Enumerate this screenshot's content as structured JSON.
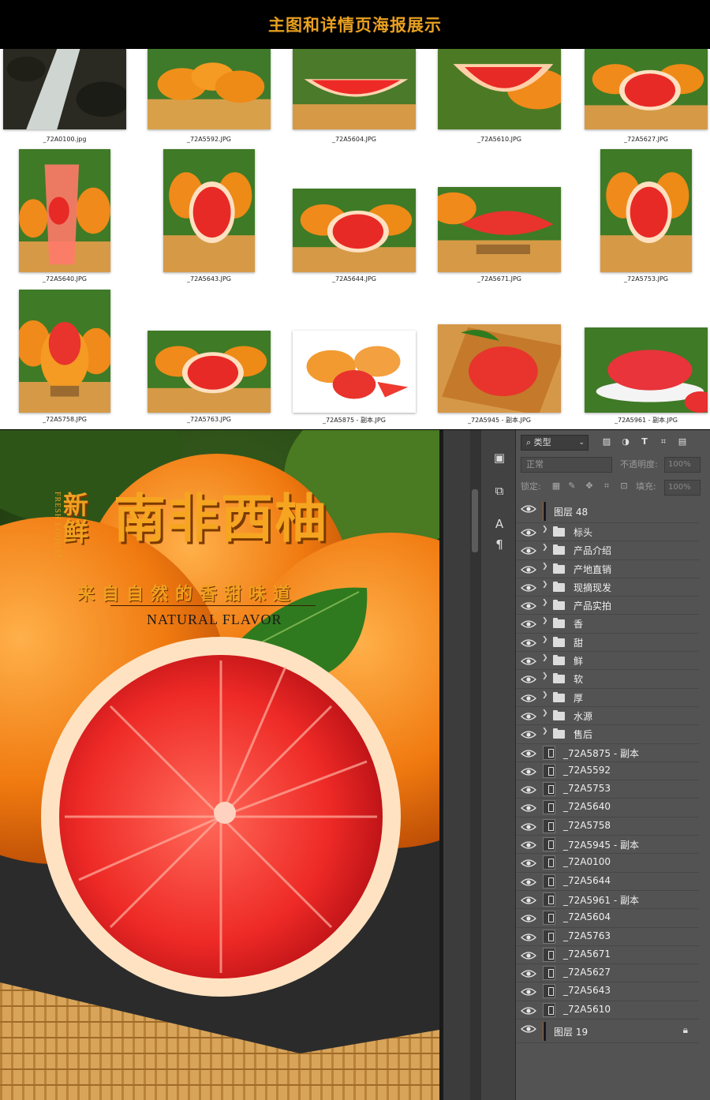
{
  "header": {
    "title": "主图和详情页海报展示"
  },
  "gallery": {
    "items": [
      {
        "name": "_72A0100.jpg",
        "kind": "waterfall"
      },
      {
        "name": "_72A5592.JPG",
        "kind": "oranges"
      },
      {
        "name": "_72A5604.JPG",
        "kind": "slice"
      },
      {
        "name": "_72A5610.JPG",
        "kind": "wedge"
      },
      {
        "name": "_72A5627.JPG",
        "kind": "halfcut"
      },
      {
        "name": "_72A5640.JPG",
        "kind": "juice"
      },
      {
        "name": "_72A5643.JPG",
        "kind": "halfcut"
      },
      {
        "name": "_72A5644.JPG",
        "kind": "halfcut"
      },
      {
        "name": "_72A5671.JPG",
        "kind": "segments"
      },
      {
        "name": "_72A5753.JPG",
        "kind": "halfcut"
      },
      {
        "name": "_72A5758.JPG",
        "kind": "bowl"
      },
      {
        "name": "_72A5763.JPG",
        "kind": "halfcut"
      },
      {
        "name": "_72A5875 - 副本.JPG",
        "kind": "white"
      },
      {
        "name": "_72A5945 - 副本.JPG",
        "kind": "tray"
      },
      {
        "name": "_72A5961 - 副本.JPG",
        "kind": "pulp"
      }
    ]
  },
  "poster": {
    "title_small": "新鲜",
    "title_big": "南非西柚",
    "side_text": "FRESH LOQUAT",
    "subtitle": "来自自然的香甜味道",
    "english": "NATURAL FLAVOR"
  },
  "ps": {
    "filter_label": "类型",
    "blend_mode": "正常",
    "opacity_label": "不透明度:",
    "opacity_value": "100%",
    "lock_label": "锁定:",
    "fill_label": "填充:",
    "fill_value": "100%",
    "layers": [
      {
        "name": "图层 48",
        "type": "pixel"
      },
      {
        "name": "标头",
        "type": "group"
      },
      {
        "name": "产品介绍",
        "type": "group"
      },
      {
        "name": "产地直销",
        "type": "group"
      },
      {
        "name": "现摘现发",
        "type": "group"
      },
      {
        "name": "产品实拍",
        "type": "group"
      },
      {
        "name": "香",
        "type": "group"
      },
      {
        "name": "甜",
        "type": "group"
      },
      {
        "name": "鲜",
        "type": "group"
      },
      {
        "name": "软",
        "type": "group"
      },
      {
        "name": "厚",
        "type": "group"
      },
      {
        "name": "水源",
        "type": "group"
      },
      {
        "name": "售后",
        "type": "group"
      },
      {
        "name": "_72A5875 - 副本",
        "type": "smart"
      },
      {
        "name": "_72A5592",
        "type": "smart"
      },
      {
        "name": "_72A5753",
        "type": "smart"
      },
      {
        "name": "_72A5640",
        "type": "smart"
      },
      {
        "name": "_72A5758",
        "type": "smart"
      },
      {
        "name": "_72A5945 - 副本",
        "type": "smart"
      },
      {
        "name": "_72A0100",
        "type": "smart"
      },
      {
        "name": "_72A5644",
        "type": "smart"
      },
      {
        "name": "_72A5961 - 副本",
        "type": "smart"
      },
      {
        "name": "_72A5604",
        "type": "smart"
      },
      {
        "name": "_72A5763",
        "type": "smart"
      },
      {
        "name": "_72A5671",
        "type": "smart"
      },
      {
        "name": "_72A5627",
        "type": "smart"
      },
      {
        "name": "_72A5643",
        "type": "smart"
      },
      {
        "name": "_72A5610",
        "type": "smart"
      },
      {
        "name": "图层 19",
        "type": "locked"
      }
    ]
  },
  "colors": {
    "accent": "#e8a020",
    "panel": "#535353",
    "grapefruit_red": "#e8222c",
    "peel_orange": "#f08a1a"
  }
}
